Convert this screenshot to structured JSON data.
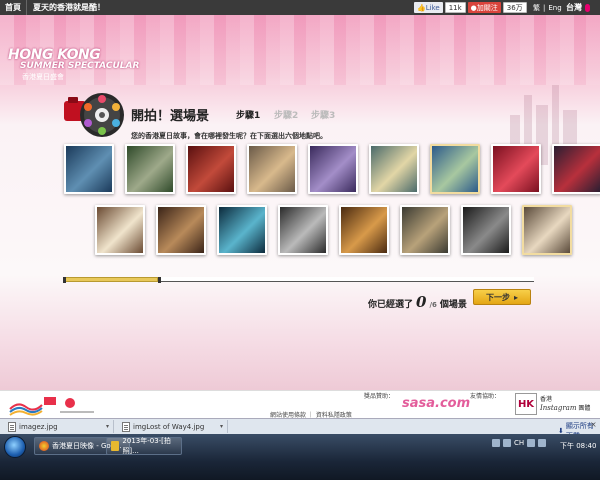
{
  "topbar": {
    "home": "首頁",
    "title": "夏天的香港就是酷！",
    "like": "Like",
    "like_count": "11k",
    "weibo": "加關注",
    "weibo_count": "36万",
    "lang_zh": "繁",
    "lang_sep": "|",
    "lang_en": "Eng",
    "region": "台灣"
  },
  "logo": {
    "line1": "HONG KONG",
    "line2": "SUMMER SPECTACULAR",
    "line3": "香港夏日盛會"
  },
  "wizard": {
    "title": "開拍！選場景",
    "step1": "步驟1",
    "step2": "步驟2",
    "step3": "步驟3",
    "question": "您的香港夏日故事，會在哪裡發生呢？在下面選出六個地點吧。",
    "selected_prefix": "你已經選了",
    "selected_count": "0",
    "selected_total": "/6",
    "selected_suffix": "個場景",
    "next_button": "下一步",
    "progress": 0.2
  },
  "thumbnails": {
    "row1": [
      {
        "label": "children-at-aquarium",
        "c1": "#1b3a5a",
        "c2": "#5f8fb2",
        "selected": false
      },
      {
        "label": "park-green-trees",
        "c1": "#2f4a2a",
        "c2": "#9ea98a",
        "selected": false
      },
      {
        "label": "red-interior-decoration",
        "c1": "#5a1010",
        "c2": "#c24a3a",
        "selected": false
      },
      {
        "label": "shopping-mall-escalator",
        "c1": "#6a5a48",
        "c2": "#d8b98c",
        "selected": false
      },
      {
        "label": "purple-lit-restaurant",
        "c1": "#3a2a5c",
        "c2": "#a38ec8",
        "selected": false
      },
      {
        "label": "dim-sum-plate",
        "c1": "#4a6a6a",
        "c2": "#e2d6a6",
        "selected": false
      },
      {
        "label": "giraffe-and-trees",
        "c1": "#2c5a8a",
        "c2": "#a8c8a0",
        "selected": true
      },
      {
        "label": "red-flowers",
        "c1": "#7a1020",
        "c2": "#e44a5a",
        "selected": false
      },
      {
        "label": "night-street-lights",
        "c1": "#2a1e32",
        "c2": "#b8303c",
        "selected": false
      }
    ],
    "row2": [
      {
        "label": "soup-bowl-spoon",
        "c1": "#6a4a32",
        "c2": "#f0e4cc",
        "selected": false
      },
      {
        "label": "people-in-shop",
        "c1": "#3a2418",
        "c2": "#b88a5a",
        "selected": false
      },
      {
        "label": "stage-blue-lights",
        "c1": "#0c2a3c",
        "c2": "#5ab4cc",
        "selected": false
      },
      {
        "label": "spiral-staircase",
        "c1": "#2a2a2a",
        "c2": "#bababa",
        "selected": false
      },
      {
        "label": "street-market-signs",
        "c1": "#4a2a10",
        "c2": "#d89a4a",
        "selected": false
      },
      {
        "label": "crowded-market-street",
        "c1": "#3a3a32",
        "c2": "#b8a27a",
        "selected": false
      },
      {
        "label": "abstract-lines",
        "c1": "#1a1a1a",
        "c2": "#8a8a8a",
        "selected": false
      },
      {
        "label": "harbour-waterfront",
        "c1": "#5a4a3a",
        "c2": "#e8d8c0",
        "selected": true
      }
    ]
  },
  "footer": {
    "sponsor_label": "獎品贊助：",
    "partner_label": "友情協助：",
    "sasa": "sasa.com",
    "links": "網站使用條款 ｜ 資料私隱政策",
    "hk_box": "HK",
    "hk_line1": "香港",
    "hk_line2": "Instagram",
    "hk_line3": "團體"
  },
  "downloads": {
    "item1": "imagez.jpg",
    "item2": "imgLost of Way4.jpg",
    "show_all": "顯示所有下載...",
    "close": "×"
  },
  "taskbar": {
    "btn1": "香港夏日映像 - Goo...",
    "btn2": "2013年-03-[拍照]...",
    "ime": "CH",
    "time": "下午 08:40"
  },
  "colors": {
    "accent_pink": "#e6006e",
    "next_button": "#f0be2e",
    "topbar": "#3a3a3a"
  }
}
